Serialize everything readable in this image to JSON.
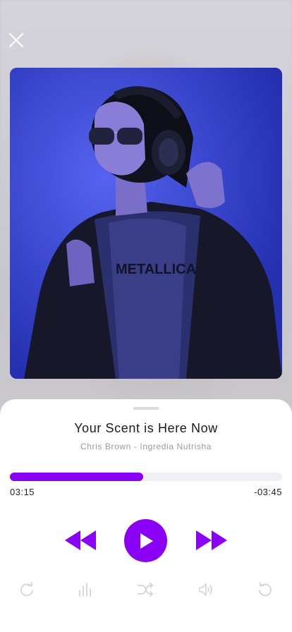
{
  "player": {
    "track_title": "Your Scent is Here Now",
    "artist_line": "Chris Brown - Ingredia Nutrisha",
    "elapsed": "03:15",
    "remaining": "-03:45",
    "progress_fraction": 0.49
  },
  "icons": {
    "close": "close-icon",
    "rewind": "rewind-icon",
    "play": "play-icon",
    "forward": "fast-forward-icon",
    "repeat": "repeat-icon",
    "equalizer": "equalizer-icon",
    "shuffle": "shuffle-icon",
    "volume": "volume-icon",
    "undo": "replay-icon"
  },
  "colors": {
    "accent": "#8a00f5",
    "track": "#f0eff4",
    "muted_icon": "#d4d4da"
  }
}
